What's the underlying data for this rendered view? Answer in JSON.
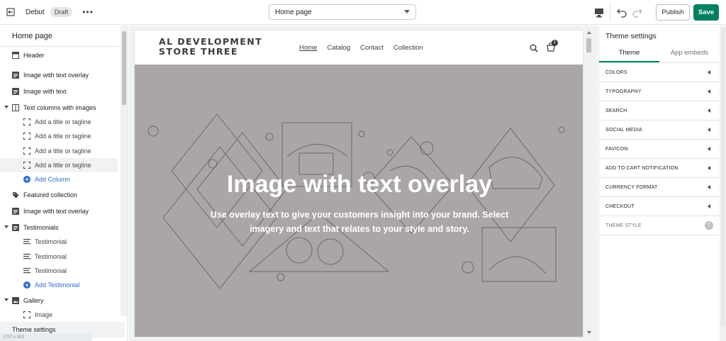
{
  "topbar": {
    "theme_name": "Debut",
    "status_badge": "Draft",
    "more_label": "•••",
    "page_selector": "Home page",
    "publish_label": "Publish",
    "save_label": "Save"
  },
  "left_sidebar": {
    "title": "Home page",
    "items": [
      {
        "label": "Header",
        "icon": "header-icon"
      },
      {
        "label": "Image with text overlay",
        "icon": "section-icon"
      },
      {
        "label": "Image with text",
        "icon": "section-icon"
      },
      {
        "label": "Text columns with images",
        "icon": "columns-icon"
      },
      {
        "label": "Add a title or tagline",
        "icon": "block-icon"
      },
      {
        "label": "Add a title or tagline",
        "icon": "block-icon"
      },
      {
        "label": "Add a title or tagline",
        "icon": "block-icon"
      },
      {
        "label": "Add a title or tagline",
        "icon": "block-icon"
      },
      {
        "label": "Add Column",
        "icon": "add-icon"
      },
      {
        "label": "Featured collection",
        "icon": "tag-icon"
      },
      {
        "label": "Image with text overlay",
        "icon": "section-icon"
      },
      {
        "label": "Testimonials",
        "icon": "section-icon"
      },
      {
        "label": "Testimonial",
        "icon": "text-icon"
      },
      {
        "label": "Testimonial",
        "icon": "text-icon"
      },
      {
        "label": "Testimonial",
        "icon": "text-icon"
      },
      {
        "label": "Add Testimonial",
        "icon": "add-icon"
      },
      {
        "label": "Gallery",
        "icon": "image-icon"
      },
      {
        "label": "Image",
        "icon": "block-icon"
      }
    ],
    "footer_link": "Theme settings",
    "taskbar_text": "1707 x 302"
  },
  "preview": {
    "store_name": "AL DEVELOPMENT\nSTORE THREE",
    "nav": [
      "Home",
      "Catalog",
      "Contact",
      "Collection"
    ],
    "cart_count": "1",
    "hero_title": "Image with text overlay",
    "hero_text": "Use overlay text to give your customers insight into your brand. Select imagery and text that relates to your style and story."
  },
  "right_sidebar": {
    "title": "Theme settings",
    "tabs": [
      "Theme",
      "App embeds"
    ],
    "settings": [
      "COLORS",
      "TYPOGRAPHY",
      "SEARCH",
      "SOCIAL MEDIA",
      "FAVICON",
      "ADD TO CART NOTIFICATION",
      "CURRENCY FORMAT",
      "CHECKOUT",
      "THEME STYLE"
    ]
  },
  "colors": {
    "save_button": "#008060",
    "hero_background": "#aba6a6",
    "link_blue": "#2c6ecb"
  }
}
